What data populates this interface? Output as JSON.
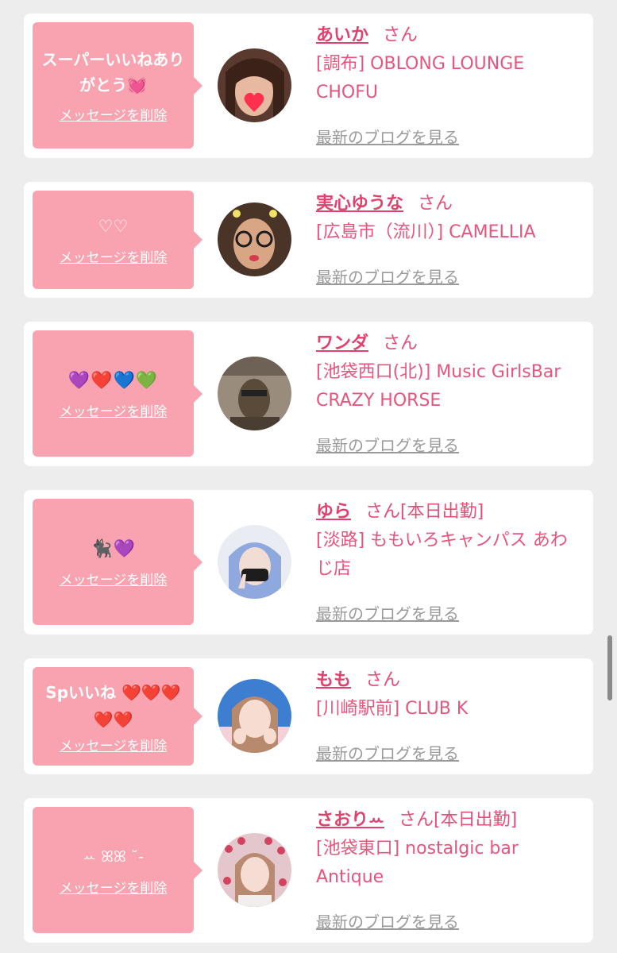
{
  "colors": {
    "page_bg": "#ededed",
    "card_bg": "#ffffff",
    "bubble_pink": "#f9a3b0",
    "accent_pink": "#e2406d",
    "blog_link_gray": "#9a9a9a"
  },
  "delete_label": "メッセージを削除",
  "blog_label": "最新のブログを見る",
  "san_label": "さん",
  "cards": [
    {
      "message": "スーパーいいねありがとう💓",
      "name": "あいか",
      "status": "",
      "shop": "[調布] OBLONG LOUNGE CHOFU",
      "avatar_icon": "avatar-photo"
    },
    {
      "message": "♡♡",
      "name": "実心ゆうな",
      "status": "",
      "shop": "[広島市（流川）] CAMELLIA",
      "avatar_icon": "avatar-photo"
    },
    {
      "message": "💜❤️💙💚",
      "name": "ワンダ",
      "status": "",
      "shop": "[池袋西口(北)] Music GirlsBar CRAZY HORSE",
      "avatar_icon": "avatar-photo"
    },
    {
      "message": "🐈‍⬛💜",
      "name": "ゆら",
      "status": "[本日出勤]",
      "shop": "[淡路] ももいろキャンパス あわじ店",
      "avatar_icon": "avatar-photo"
    },
    {
      "message": "Spいいね ❤️❤️❤️❤️❤️",
      "name": "もも",
      "status": "",
      "shop": "[川崎駅前] CLUB K",
      "avatar_icon": "avatar-photo"
    },
    {
      "message": "ꕀ ꕤꕤ ˘-",
      "name": "さおりꕀ",
      "status": "[本日出勤]",
      "shop": "[池袋東口] nostalgic bar Antique",
      "avatar_icon": "avatar-photo"
    }
  ]
}
